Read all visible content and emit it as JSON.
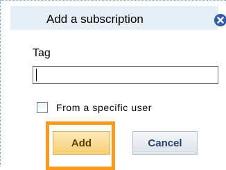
{
  "dialog": {
    "title": "Add a subscription",
    "close_icon": "close-circle-icon"
  },
  "form": {
    "tag_label": "Tag",
    "tag_value": "",
    "specific_user_label": "From a specific user",
    "specific_user_checked": false
  },
  "buttons": {
    "add_label": "Add",
    "cancel_label": "Cancel"
  },
  "colors": {
    "title_bar": "#e6eef7",
    "close_icon": "#2f5fa7",
    "highlight": "#f79a1e",
    "add_button": "#f9cf74",
    "cancel_text": "#24446e"
  }
}
